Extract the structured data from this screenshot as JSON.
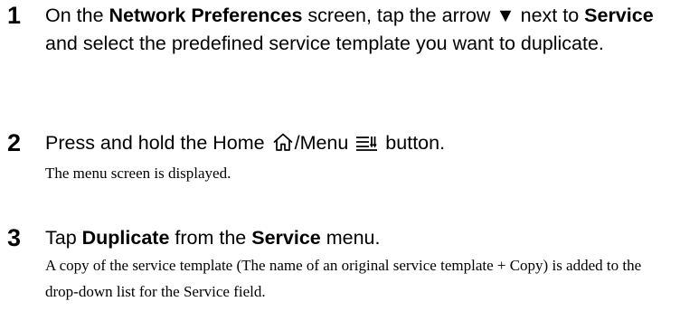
{
  "steps": [
    {
      "number": "1",
      "instruction": {
        "t1": "On the ",
        "b1": "Network Preferences",
        "t2": " screen, tap the arrow ",
        "arrow_glyph": "▼",
        "t3": " next to ",
        "b2": "Service",
        "t4": " and select the predefined service template you want to duplicate."
      }
    },
    {
      "number": "2",
      "instruction": {
        "t1": "Press and hold the Home ",
        "t2": "/Menu ",
        "t3": " button."
      },
      "icons": [
        "home-icon",
        "menu-icon"
      ],
      "result": "The menu screen is displayed."
    },
    {
      "number": "3",
      "instruction": {
        "t1": "Tap ",
        "b1": "Duplicate",
        "t2": " from the ",
        "b2": "Service",
        "t3": " menu."
      },
      "result": "A copy of the service template (The name of an original service template + Copy) is added to the drop-down list for the Service field."
    }
  ]
}
